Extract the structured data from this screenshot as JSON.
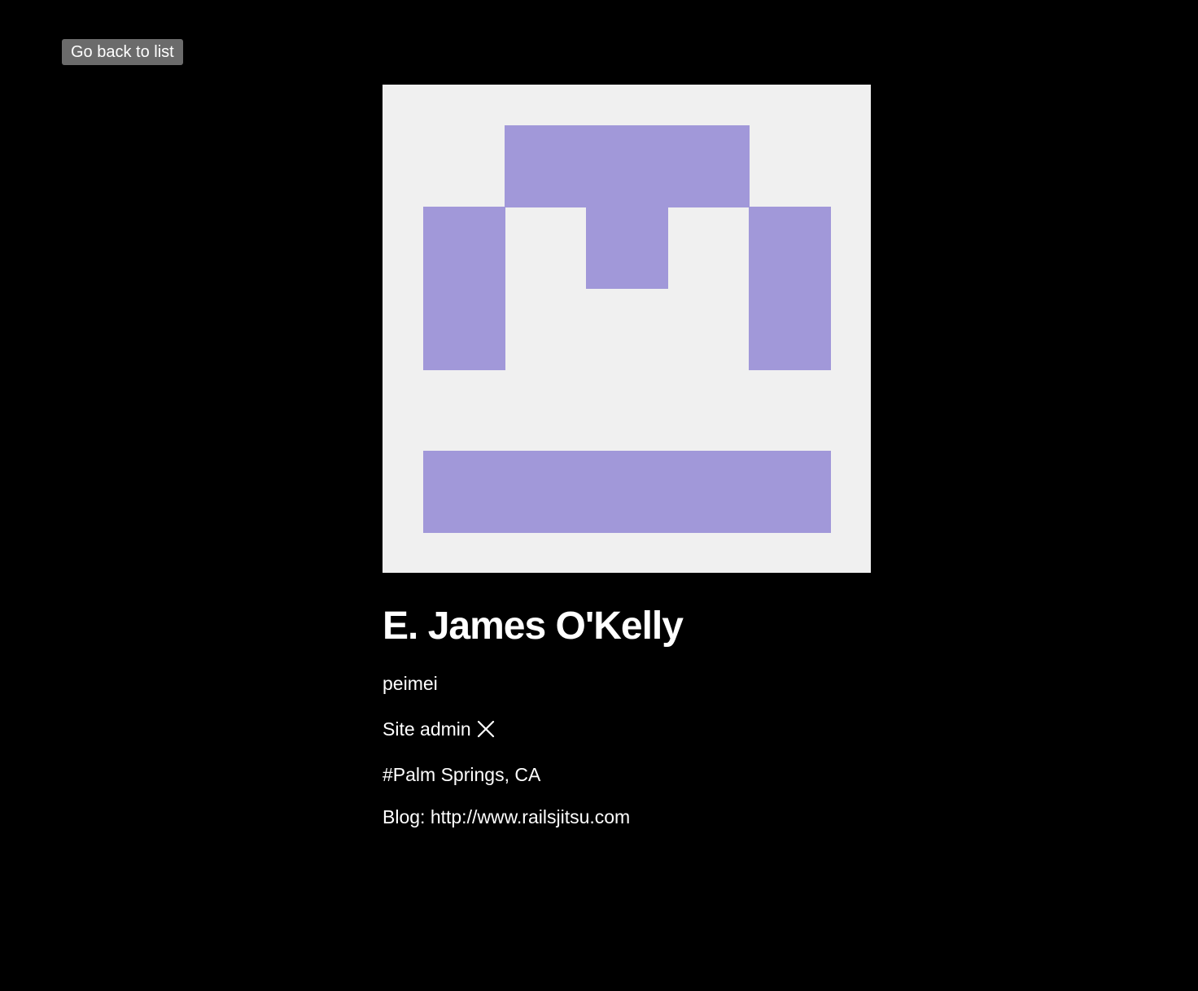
{
  "nav": {
    "back_label": "Go back to list"
  },
  "profile": {
    "avatar": {
      "icon": "identicon-avatar",
      "background": "#f0f0f0",
      "foreground": "#a198d9"
    },
    "name": "E. James O'Kelly",
    "login": "peimei",
    "site_admin_label": "Site admin",
    "site_admin_icon": "x-mark-icon",
    "location": "#Palm Springs, CA",
    "blog": "Blog: http://www.railsjitsu.com"
  }
}
